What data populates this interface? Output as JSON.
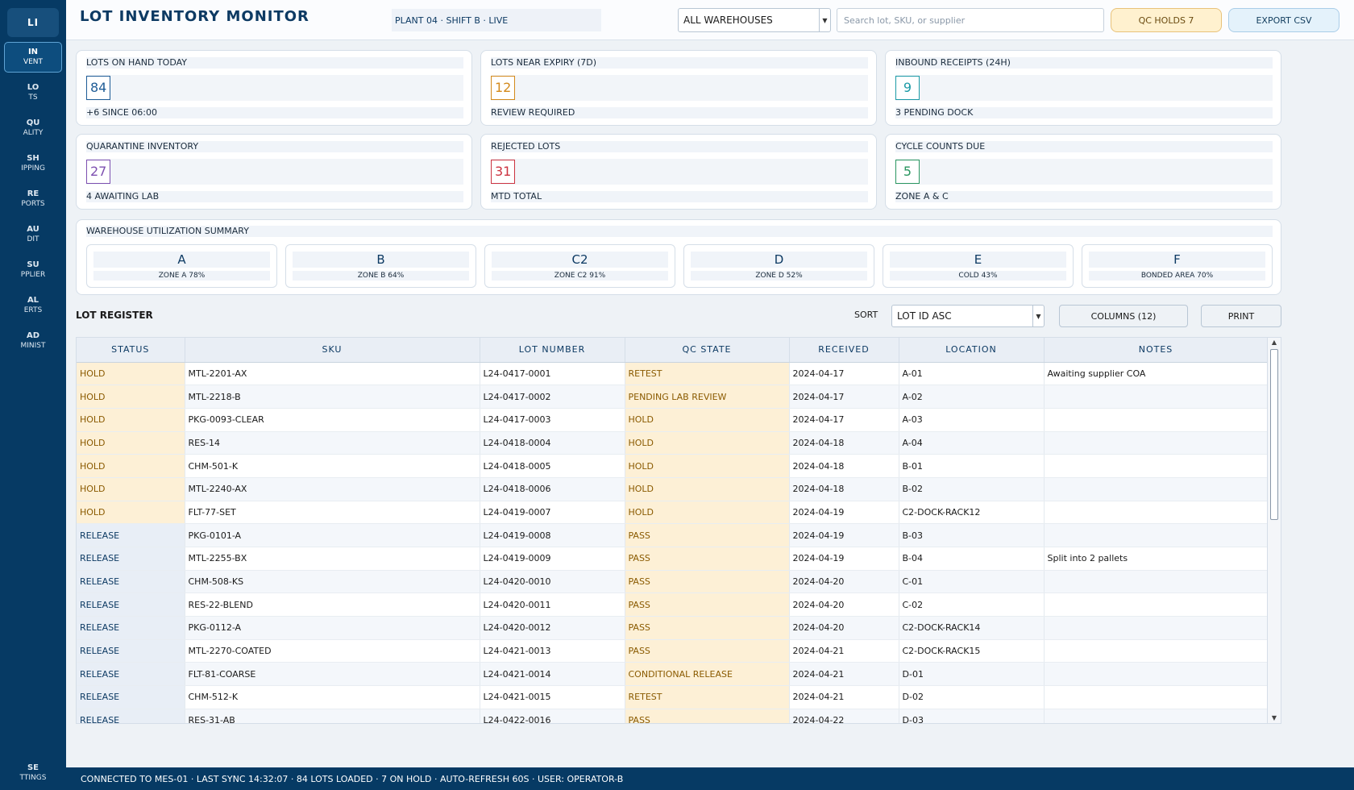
{
  "app": {
    "logo": "LI",
    "title": "LOT INVENTORY MONITOR",
    "subtitle": "PLANT 04 · SHIFT B · LIVE"
  },
  "sidebar": {
    "items": [
      {
        "l1": "IN",
        "l2": "VENT"
      },
      {
        "l1": "LO",
        "l2": "TS"
      },
      {
        "l1": "QU",
        "l2": "ALITY"
      },
      {
        "l1": "SH",
        "l2": "IPPING"
      },
      {
        "l1": "RE",
        "l2": "PORTS"
      },
      {
        "l1": "AU",
        "l2": "DIT"
      },
      {
        "l1": "SU",
        "l2": "PPLIER"
      },
      {
        "l1": "AL",
        "l2": "ERTS"
      },
      {
        "l1": "AD",
        "l2": "MINIST"
      }
    ],
    "footer": {
      "l1": "SE",
      "l2": "TTINGS"
    }
  },
  "header": {
    "filter_value": "ALL WAREHOUSES",
    "search_placeholder": "Search lot, SKU, or supplier",
    "btn_warn": "QC HOLDS 7",
    "btn_info": "EXPORT CSV"
  },
  "cards": [
    {
      "title": "LOTS ON HAND TODAY",
      "value": "84",
      "sub": "+6 SINCE 06:00",
      "color": "#1f5c96"
    },
    {
      "title": "LOTS NEAR EXPIRY (7D)",
      "value": "12",
      "sub": "REVIEW REQUIRED",
      "color": "#d38a1c"
    },
    {
      "title": "INBOUND RECEIPTS (24H)",
      "value": "9",
      "sub": "3 PENDING DOCK",
      "color": "#1b9aa6"
    },
    {
      "title": "QUARANTINE INVENTORY",
      "value": "27",
      "sub": "4 AWAITING LAB",
      "color": "#7d4fb0"
    },
    {
      "title": "REJECTED LOTS",
      "value": "31",
      "sub": "MTD TOTAL",
      "color": "#cc3340"
    },
    {
      "title": "CYCLE COUNTS DUE",
      "value": "5",
      "sub": "ZONE A & C",
      "color": "#2a9660"
    }
  ],
  "stats": {
    "title": "WAREHOUSE UTILIZATION SUMMARY",
    "tiles": [
      {
        "value": "A",
        "label": "ZONE A 78%"
      },
      {
        "value": "B",
        "label": "ZONE B 64%"
      },
      {
        "value": "C2",
        "label": "ZONE C2 91%"
      },
      {
        "value": "D",
        "label": "ZONE D 52%"
      },
      {
        "value": "E",
        "label": "COLD 43%"
      },
      {
        "value": "F",
        "label": "BONDED AREA 70%"
      }
    ]
  },
  "toolbar": {
    "label": "LOT REGISTER",
    "sort_label": "SORT",
    "sort_value": "LOT ID ASC",
    "btn_columns": "COLUMNS (12)",
    "btn_print": "PRINT"
  },
  "table": {
    "columns": [
      "STATUS",
      "SKU",
      "LOT NUMBER",
      "QC STATE",
      "RECEIVED",
      "LOCATION",
      "NOTES"
    ],
    "rows": [
      {
        "c0": "HOLD",
        "c1": "MTL-2201-AX",
        "c2": "L24-0417-0001",
        "c3": "RETEST",
        "c4": "2024-04-17",
        "c5": "A-01",
        "c6": "Awaiting supplier COA",
        "hl": true
      },
      {
        "c0": "HOLD",
        "c1": "MTL-2218-B",
        "c2": "L24-0417-0002",
        "c3": "PENDING LAB REVIEW",
        "c4": "2024-04-17",
        "c5": "A-02",
        "c6": "",
        "hl": true
      },
      {
        "c0": "HOLD",
        "c1": "PKG-0093-CLEAR",
        "c2": "L24-0417-0003",
        "c3": "HOLD",
        "c4": "2024-04-17",
        "c5": "A-03",
        "c6": "",
        "hl": true
      },
      {
        "c0": "HOLD",
        "c1": "RES-14",
        "c2": "L24-0418-0004",
        "c3": "HOLD",
        "c4": "2024-04-18",
        "c5": "A-04",
        "c6": "",
        "hl": true
      },
      {
        "c0": "HOLD",
        "c1": "CHM-501-K",
        "c2": "L24-0418-0005",
        "c3": "HOLD",
        "c4": "2024-04-18",
        "c5": "B-01",
        "c6": "",
        "hl": true
      },
      {
        "c0": "HOLD",
        "c1": "MTL-2240-AX",
        "c2": "L24-0418-0006",
        "c3": "HOLD",
        "c4": "2024-04-18",
        "c5": "B-02",
        "c6": "",
        "hl": true
      },
      {
        "c0": "HOLD",
        "c1": "FLT-77-SET",
        "c2": "L24-0419-0007",
        "c3": "HOLD",
        "c4": "2024-04-19",
        "c5": "C2-DOCK-RACK12",
        "c6": "",
        "hl": true
      },
      {
        "c0": "RELEASE",
        "c1": "PKG-0101-A",
        "c2": "L24-0419-0008",
        "c3": "PASS",
        "c4": "2024-04-19",
        "c5": "B-03",
        "c6": "",
        "hl": false
      },
      {
        "c0": "RELEASE",
        "c1": "MTL-2255-BX",
        "c2": "L24-0419-0009",
        "c3": "PASS",
        "c4": "2024-04-19",
        "c5": "B-04",
        "c6": "Split into 2 pallets",
        "hl": false
      },
      {
        "c0": "RELEASE",
        "c1": "CHM-508-KS",
        "c2": "L24-0420-0010",
        "c3": "PASS",
        "c4": "2024-04-20",
        "c5": "C-01",
        "c6": "",
        "hl": false
      },
      {
        "c0": "RELEASE",
        "c1": "RES-22-BLEND",
        "c2": "L24-0420-0011",
        "c3": "PASS",
        "c4": "2024-04-20",
        "c5": "C-02",
        "c6": "",
        "hl": false
      },
      {
        "c0": "RELEASE",
        "c1": "PKG-0112-A",
        "c2": "L24-0420-0012",
        "c3": "PASS",
        "c4": "2024-04-20",
        "c5": "C2-DOCK-RACK14",
        "c6": "",
        "hl": false
      },
      {
        "c0": "RELEASE",
        "c1": "MTL-2270-COATED",
        "c2": "L24-0421-0013",
        "c3": "PASS",
        "c4": "2024-04-21",
        "c5": "C2-DOCK-RACK15",
        "c6": "",
        "hl": false
      },
      {
        "c0": "RELEASE",
        "c1": "FLT-81-COARSE",
        "c2": "L24-0421-0014",
        "c3": "CONDITIONAL RELEASE",
        "c4": "2024-04-21",
        "c5": "D-01",
        "c6": "",
        "hl": false
      },
      {
        "c0": "RELEASE",
        "c1": "CHM-512-K",
        "c2": "L24-0421-0015",
        "c3": "RETEST",
        "c4": "2024-04-21",
        "c5": "D-02",
        "c6": "",
        "hl": false
      },
      {
        "c0": "RELEASE",
        "c1": "RES-31-AB",
        "c2": "L24-0422-0016",
        "c3": "PASS",
        "c4": "2024-04-22",
        "c5": "D-03",
        "c6": "",
        "hl": false
      }
    ]
  },
  "statusbar": {
    "text": "CONNECTED TO MES-01 · LAST SYNC 14:32:07 · 84 LOTS LOADED · 7 ON HOLD · AUTO-REFRESH 60S · USER: OPERATOR-B"
  }
}
